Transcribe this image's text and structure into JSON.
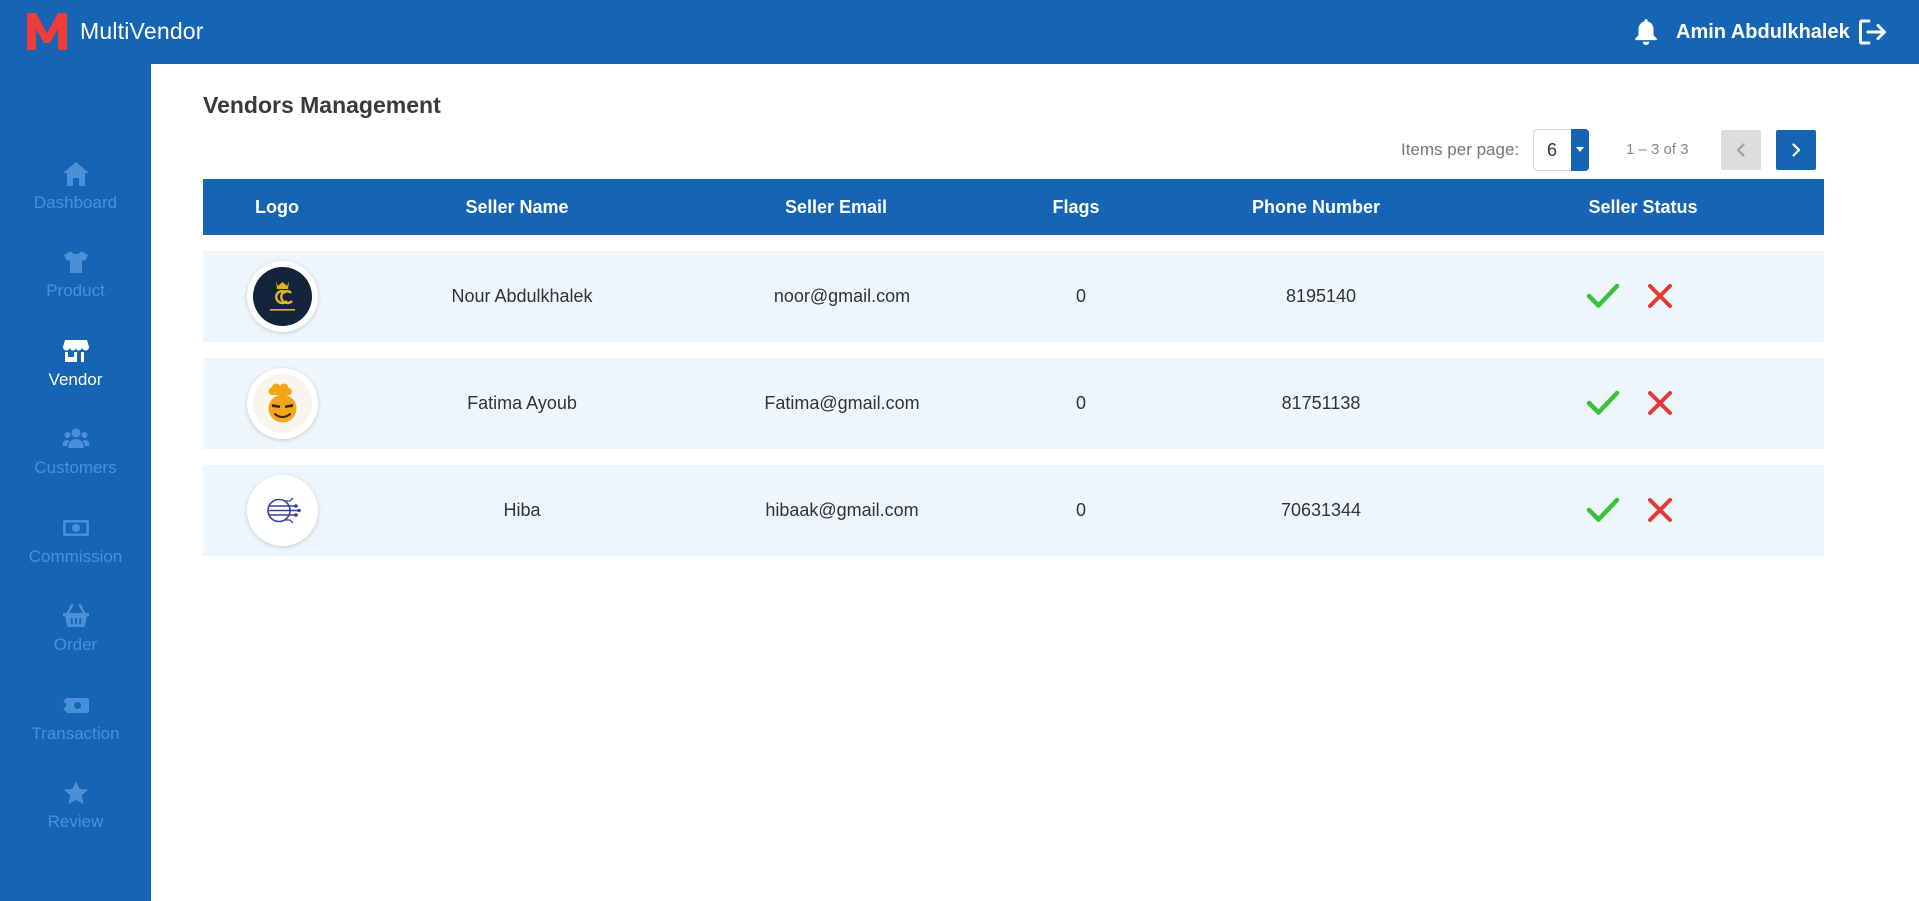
{
  "app": {
    "name": "MultiVendor",
    "logo_letter": "M"
  },
  "header": {
    "username": "Amin Abdulkhalek",
    "icons": [
      "bell-icon",
      "logout-icon"
    ]
  },
  "sidebar": {
    "items": [
      {
        "label": "Dashboard",
        "icon": "home-icon",
        "active": false
      },
      {
        "label": "Product",
        "icon": "shirt-icon",
        "active": false
      },
      {
        "label": "Vendor",
        "icon": "store-icon",
        "active": true
      },
      {
        "label": "Customers",
        "icon": "users-icon",
        "active": false
      },
      {
        "label": "Commission",
        "icon": "money-icon",
        "active": false
      },
      {
        "label": "Order",
        "icon": "basket-icon",
        "active": false
      },
      {
        "label": "Transaction",
        "icon": "money-transfer-icon",
        "active": false
      },
      {
        "label": "Review",
        "icon": "star-icon",
        "active": false
      }
    ]
  },
  "main": {
    "title": "Vendors Management",
    "pagination": {
      "items_per_page_label": "Items per page:",
      "items_per_page": "6",
      "range": "1 – 3 of 3"
    },
    "table": {
      "headers": [
        "Logo",
        "Seller Name",
        "Seller Email",
        "Flags",
        "Phone Number",
        "Seller Status"
      ],
      "rows": [
        {
          "name": "Nour Abdulkhalek",
          "email": "noor@gmail.com",
          "flags": "0",
          "phone": "8195140",
          "logo": "queens-clothes-logo"
        },
        {
          "name": "Fatima Ayoub",
          "email": "Fatima@gmail.com",
          "flags": "0",
          "phone": "81751138",
          "logo": "chef-emoji-logo"
        },
        {
          "name": "Hiba",
          "email": "hibaak@gmail.com",
          "flags": "0",
          "phone": "70631344",
          "logo": "circuit-logo"
        }
      ]
    }
  },
  "colors": {
    "primary": "#1565b4",
    "row_bg": "#eef6fd",
    "approve": "#3cc13b",
    "reject": "#e53935",
    "sidebar_inactive": "#4b8fd6"
  }
}
